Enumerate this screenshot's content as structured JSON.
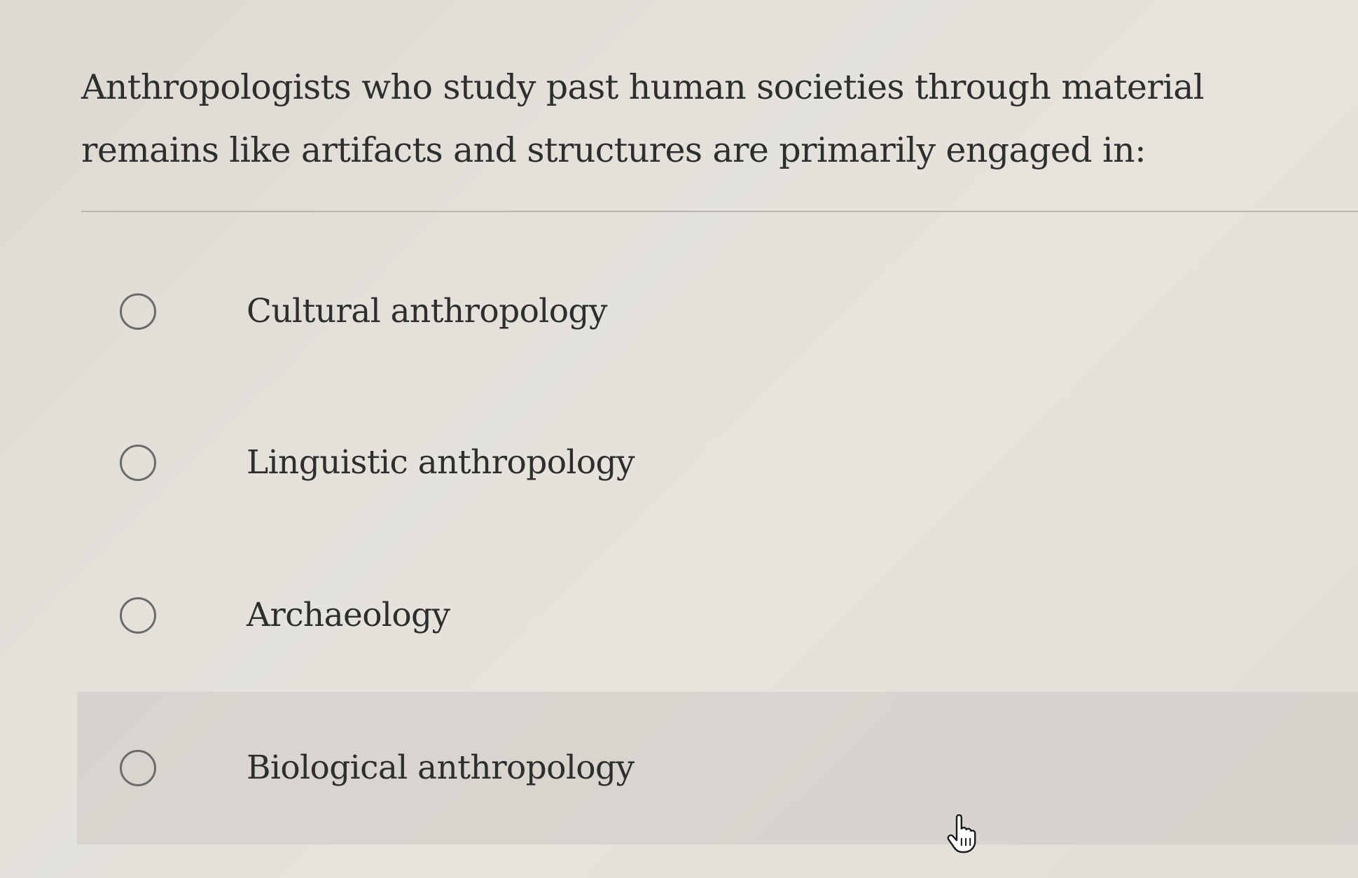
{
  "question": {
    "text": "Anthropologists who study past human societies through material remains like artifacts and structures are primarily engaged in:"
  },
  "options": [
    {
      "label": "Cultural anthropology",
      "selected": false
    },
    {
      "label": "Linguistic anthropology",
      "selected": false
    },
    {
      "label": "Archaeology",
      "selected": false
    },
    {
      "label": "Biological anthropology",
      "selected": false
    }
  ],
  "cursor": {
    "icon": "hand-pointer-icon"
  }
}
